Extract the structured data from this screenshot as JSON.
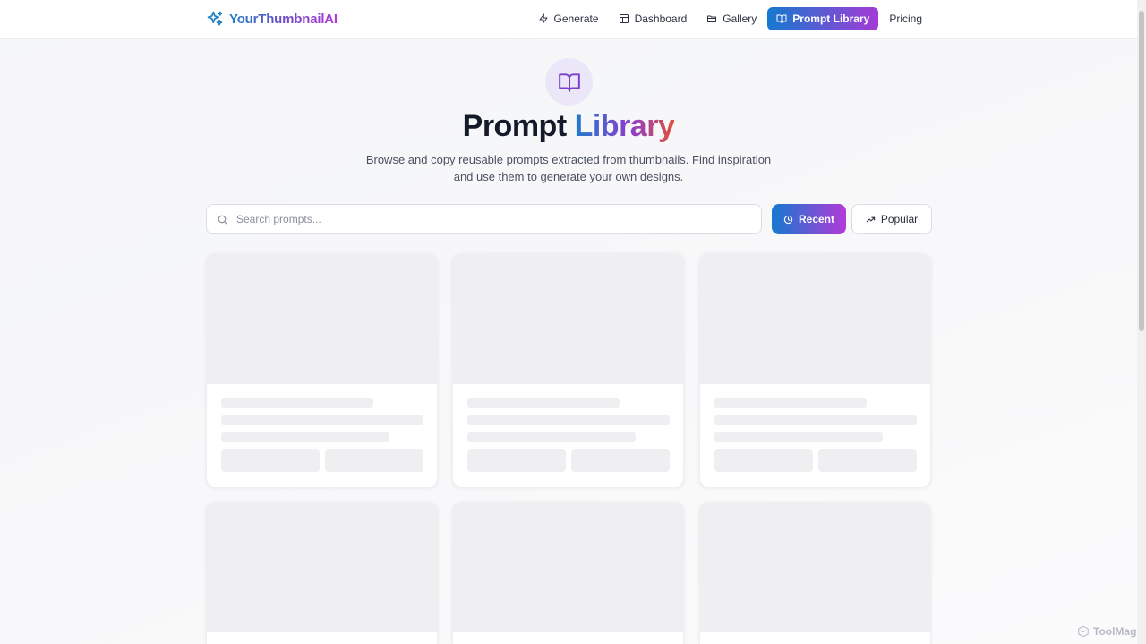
{
  "brand": {
    "name": "YourThumbnailAI",
    "color_start": "#1b7fc6",
    "color_end": "#b23bd2"
  },
  "nav": {
    "items": [
      {
        "label": "Generate",
        "icon": "zap-icon"
      },
      {
        "label": "Dashboard",
        "icon": "layout-icon"
      },
      {
        "label": "Gallery",
        "icon": "folder-icon"
      },
      {
        "label": "Prompt Library",
        "icon": "book-open-icon",
        "active": true
      },
      {
        "label": "Pricing"
      }
    ]
  },
  "hero": {
    "icon": "book-open-icon",
    "title_part1": "Prompt ",
    "title_part2": "Library",
    "subtitle": "Browse and copy reusable prompts extracted from thumbnails. Find inspiration and use them to generate your own designs."
  },
  "search": {
    "placeholder": "Search prompts...",
    "value": ""
  },
  "filters": {
    "recent_label": "Recent",
    "popular_label": "Popular",
    "selected": "Recent"
  },
  "cards": {
    "state": "loading",
    "count": 6
  },
  "watermark": {
    "text": "ToolMage"
  }
}
